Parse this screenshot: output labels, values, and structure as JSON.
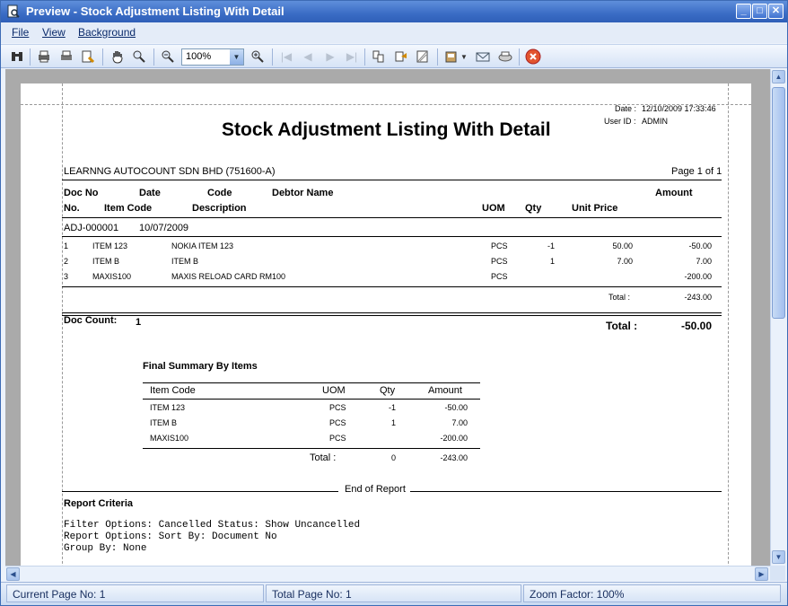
{
  "window": {
    "title": "Preview - Stock Adjustment Listing With Detail",
    "min_glyph": "_",
    "max_glyph": "□",
    "close_glyph": "✕"
  },
  "menu": {
    "file": "File",
    "view": "View",
    "background": "Background"
  },
  "toolbar": {
    "zoom_value": "100%"
  },
  "status": {
    "current_page": "Current Page No: 1",
    "total_page": "Total Page No: 1",
    "zoom_factor": "Zoom Factor: 100%"
  },
  "report": {
    "date_label": "Date :",
    "date_value": "12/10/2009 17:33:46",
    "user_label": "User ID :",
    "user_value": "ADMIN",
    "title": "Stock Adjustment Listing With Detail",
    "company": "LEARNNG AUTOCOUNT SDN BHD (751600-A)",
    "page_info": "Page 1 of 1",
    "headers": {
      "doc_no": "Doc No",
      "date": "Date",
      "code": "Code",
      "debtor_name": "Debtor Name",
      "amount": "Amount",
      "no": "No.",
      "item_code": "Item Code",
      "description": "Description",
      "uom": "UOM",
      "qty": "Qty",
      "unit_price": "Unit Price"
    },
    "doc": {
      "doc_no": "ADJ-000001",
      "date": "10/07/2009"
    },
    "rows": [
      {
        "no": "1",
        "item_code": "ITEM 123",
        "description": "NOKIA ITEM 123",
        "uom": "PCS",
        "qty": "-1",
        "unit_price": "50.00",
        "amount": "-50.00"
      },
      {
        "no": "2",
        "item_code": "ITEM B",
        "description": "ITEM B",
        "uom": "PCS",
        "qty": "1",
        "unit_price": "7.00",
        "amount": "7.00"
      },
      {
        "no": "3",
        "item_code": "MAXIS100",
        "description": "MAXIS RELOAD CARD RM100",
        "uom": "PCS",
        "qty": "",
        "unit_price": "",
        "amount": "-200.00"
      }
    ],
    "doc_total_label": "Total :",
    "doc_total_value": "-243.00",
    "doc_count_label": "Doc Count:",
    "doc_count_value": "1",
    "grand_total_label": "Total :",
    "grand_total_value": "-50.00",
    "summary": {
      "title": "Final Summary By Items",
      "headers": {
        "item_code": "Item Code",
        "uom": "UOM",
        "qty": "Qty",
        "amount": "Amount"
      },
      "rows": [
        {
          "item_code": "ITEM 123",
          "uom": "PCS",
          "qty": "-1",
          "amount": "-50.00"
        },
        {
          "item_code": "ITEM B",
          "uom": "PCS",
          "qty": "1",
          "amount": "7.00"
        },
        {
          "item_code": "MAXIS100",
          "uom": "PCS",
          "qty": "",
          "amount": "-200.00"
        }
      ],
      "total_label": "Total :",
      "total_qty": "0",
      "total_amount": "-243.00"
    },
    "end_of_report": "End of Report",
    "criteria_title": "Report Criteria",
    "criteria_lines": [
      "Filter Options: Cancelled Status: Show Uncancelled",
      "Report Options: Sort By: Document No",
      "                Group By: None"
    ]
  }
}
